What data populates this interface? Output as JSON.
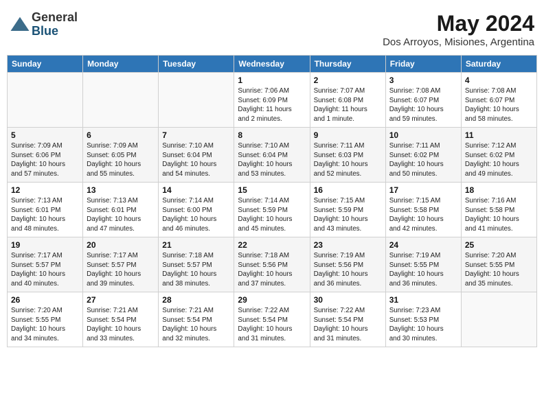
{
  "header": {
    "logo_general": "General",
    "logo_blue": "Blue",
    "month_title": "May 2024",
    "location": "Dos Arroyos, Misiones, Argentina"
  },
  "days_of_week": [
    "Sunday",
    "Monday",
    "Tuesday",
    "Wednesday",
    "Thursday",
    "Friday",
    "Saturday"
  ],
  "weeks": [
    [
      {
        "day": "",
        "info": ""
      },
      {
        "day": "",
        "info": ""
      },
      {
        "day": "",
        "info": ""
      },
      {
        "day": "1",
        "info": "Sunrise: 7:06 AM\nSunset: 6:09 PM\nDaylight: 11 hours\nand 2 minutes."
      },
      {
        "day": "2",
        "info": "Sunrise: 7:07 AM\nSunset: 6:08 PM\nDaylight: 11 hours\nand 1 minute."
      },
      {
        "day": "3",
        "info": "Sunrise: 7:08 AM\nSunset: 6:07 PM\nDaylight: 10 hours\nand 59 minutes."
      },
      {
        "day": "4",
        "info": "Sunrise: 7:08 AM\nSunset: 6:07 PM\nDaylight: 10 hours\nand 58 minutes."
      }
    ],
    [
      {
        "day": "5",
        "info": "Sunrise: 7:09 AM\nSunset: 6:06 PM\nDaylight: 10 hours\nand 57 minutes."
      },
      {
        "day": "6",
        "info": "Sunrise: 7:09 AM\nSunset: 6:05 PM\nDaylight: 10 hours\nand 55 minutes."
      },
      {
        "day": "7",
        "info": "Sunrise: 7:10 AM\nSunset: 6:04 PM\nDaylight: 10 hours\nand 54 minutes."
      },
      {
        "day": "8",
        "info": "Sunrise: 7:10 AM\nSunset: 6:04 PM\nDaylight: 10 hours\nand 53 minutes."
      },
      {
        "day": "9",
        "info": "Sunrise: 7:11 AM\nSunset: 6:03 PM\nDaylight: 10 hours\nand 52 minutes."
      },
      {
        "day": "10",
        "info": "Sunrise: 7:11 AM\nSunset: 6:02 PM\nDaylight: 10 hours\nand 50 minutes."
      },
      {
        "day": "11",
        "info": "Sunrise: 7:12 AM\nSunset: 6:02 PM\nDaylight: 10 hours\nand 49 minutes."
      }
    ],
    [
      {
        "day": "12",
        "info": "Sunrise: 7:13 AM\nSunset: 6:01 PM\nDaylight: 10 hours\nand 48 minutes."
      },
      {
        "day": "13",
        "info": "Sunrise: 7:13 AM\nSunset: 6:01 PM\nDaylight: 10 hours\nand 47 minutes."
      },
      {
        "day": "14",
        "info": "Sunrise: 7:14 AM\nSunset: 6:00 PM\nDaylight: 10 hours\nand 46 minutes."
      },
      {
        "day": "15",
        "info": "Sunrise: 7:14 AM\nSunset: 5:59 PM\nDaylight: 10 hours\nand 45 minutes."
      },
      {
        "day": "16",
        "info": "Sunrise: 7:15 AM\nSunset: 5:59 PM\nDaylight: 10 hours\nand 43 minutes."
      },
      {
        "day": "17",
        "info": "Sunrise: 7:15 AM\nSunset: 5:58 PM\nDaylight: 10 hours\nand 42 minutes."
      },
      {
        "day": "18",
        "info": "Sunrise: 7:16 AM\nSunset: 5:58 PM\nDaylight: 10 hours\nand 41 minutes."
      }
    ],
    [
      {
        "day": "19",
        "info": "Sunrise: 7:17 AM\nSunset: 5:57 PM\nDaylight: 10 hours\nand 40 minutes."
      },
      {
        "day": "20",
        "info": "Sunrise: 7:17 AM\nSunset: 5:57 PM\nDaylight: 10 hours\nand 39 minutes."
      },
      {
        "day": "21",
        "info": "Sunrise: 7:18 AM\nSunset: 5:57 PM\nDaylight: 10 hours\nand 38 minutes."
      },
      {
        "day": "22",
        "info": "Sunrise: 7:18 AM\nSunset: 5:56 PM\nDaylight: 10 hours\nand 37 minutes."
      },
      {
        "day": "23",
        "info": "Sunrise: 7:19 AM\nSunset: 5:56 PM\nDaylight: 10 hours\nand 36 minutes."
      },
      {
        "day": "24",
        "info": "Sunrise: 7:19 AM\nSunset: 5:55 PM\nDaylight: 10 hours\nand 36 minutes."
      },
      {
        "day": "25",
        "info": "Sunrise: 7:20 AM\nSunset: 5:55 PM\nDaylight: 10 hours\nand 35 minutes."
      }
    ],
    [
      {
        "day": "26",
        "info": "Sunrise: 7:20 AM\nSunset: 5:55 PM\nDaylight: 10 hours\nand 34 minutes."
      },
      {
        "day": "27",
        "info": "Sunrise: 7:21 AM\nSunset: 5:54 PM\nDaylight: 10 hours\nand 33 minutes."
      },
      {
        "day": "28",
        "info": "Sunrise: 7:21 AM\nSunset: 5:54 PM\nDaylight: 10 hours\nand 32 minutes."
      },
      {
        "day": "29",
        "info": "Sunrise: 7:22 AM\nSunset: 5:54 PM\nDaylight: 10 hours\nand 31 minutes."
      },
      {
        "day": "30",
        "info": "Sunrise: 7:22 AM\nSunset: 5:54 PM\nDaylight: 10 hours\nand 31 minutes."
      },
      {
        "day": "31",
        "info": "Sunrise: 7:23 AM\nSunset: 5:53 PM\nDaylight: 10 hours\nand 30 minutes."
      },
      {
        "day": "",
        "info": ""
      }
    ]
  ]
}
